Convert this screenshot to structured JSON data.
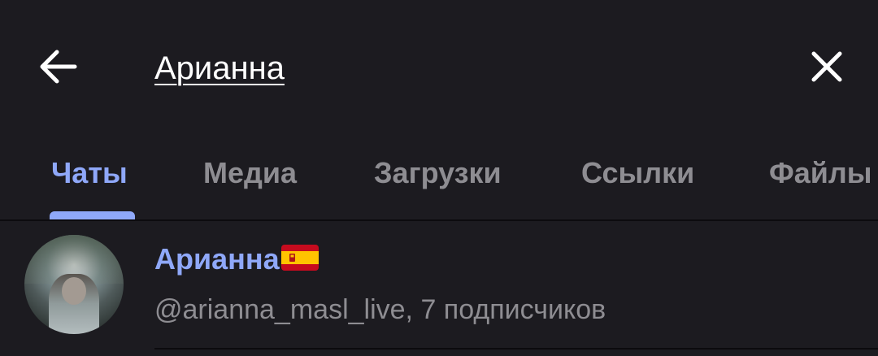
{
  "search": {
    "query": "Арианна",
    "back_icon": "arrow-left-icon",
    "clear_icon": "close-icon"
  },
  "tabs": [
    {
      "label": "Чаты",
      "active": true
    },
    {
      "label": "Медиа",
      "active": false
    },
    {
      "label": "Загрузки",
      "active": false
    },
    {
      "label": "Ссылки",
      "active": false
    },
    {
      "label": "Файлы",
      "active": false
    }
  ],
  "results": [
    {
      "name": "Арианна",
      "flag_icon": "spain-flag-icon",
      "subtitle": "@arianna_masl_live, 7 подписчиков"
    }
  ],
  "colors": {
    "background": "#1c1b20",
    "accent": "#8fa8f9",
    "secondary_text": "#8e8d92",
    "primary_text": "#ffffff"
  }
}
